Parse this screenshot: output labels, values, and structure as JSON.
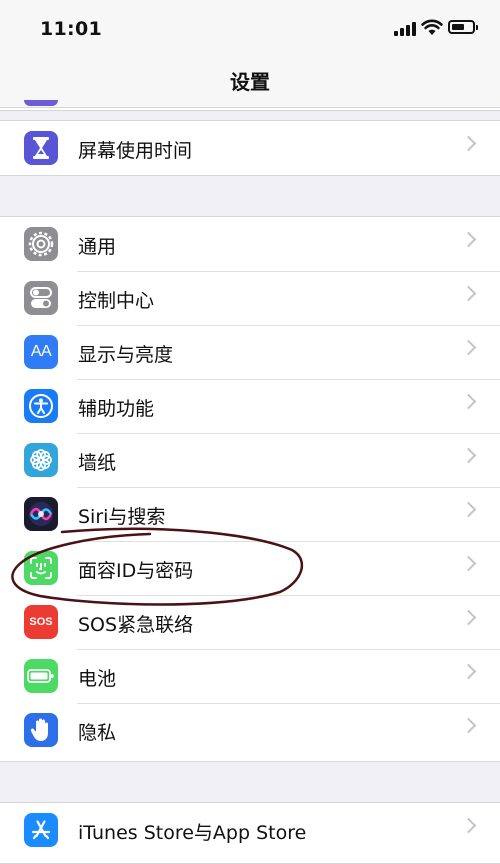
{
  "status_bar": {
    "time": "11:01"
  },
  "nav": {
    "title": "设置"
  },
  "groups": [
    {
      "rows": [
        {
          "label": "屏幕使用时间",
          "icon": "hourglass-icon",
          "color": "#5856d6"
        }
      ]
    },
    {
      "rows": [
        {
          "label": "通用",
          "icon": "gear-icon",
          "color": "#8e8e93"
        },
        {
          "label": "控制中心",
          "icon": "toggles-icon",
          "color": "#8e8e93"
        },
        {
          "label": "显示与亮度",
          "icon": "text-size-icon",
          "color": "#2f7cf6"
        },
        {
          "label": "辅助功能",
          "icon": "accessibility-icon",
          "color": "#1a7cf5"
        },
        {
          "label": "墙纸",
          "icon": "flower-icon",
          "color": "#32a6da"
        },
        {
          "label": "Siri与搜索",
          "icon": "siri-icon",
          "color": "#1b1b2e"
        },
        {
          "label": "面容ID与密码",
          "icon": "face-id-icon",
          "color": "#4cd964"
        },
        {
          "label": "SOS紧急联络",
          "icon": "sos-icon",
          "color": "#ec3b33"
        },
        {
          "label": "电池",
          "icon": "battery-icon",
          "color": "#4cd964"
        },
        {
          "label": "隐私",
          "icon": "hand-icon",
          "color": "#2c6fe8"
        }
      ]
    },
    {
      "rows": [
        {
          "label": "iTunes Store与App Store",
          "icon": "app-store-icon",
          "color": "#1a8cff"
        }
      ]
    }
  ],
  "sos_text": "SOS",
  "aa_text": "AA"
}
